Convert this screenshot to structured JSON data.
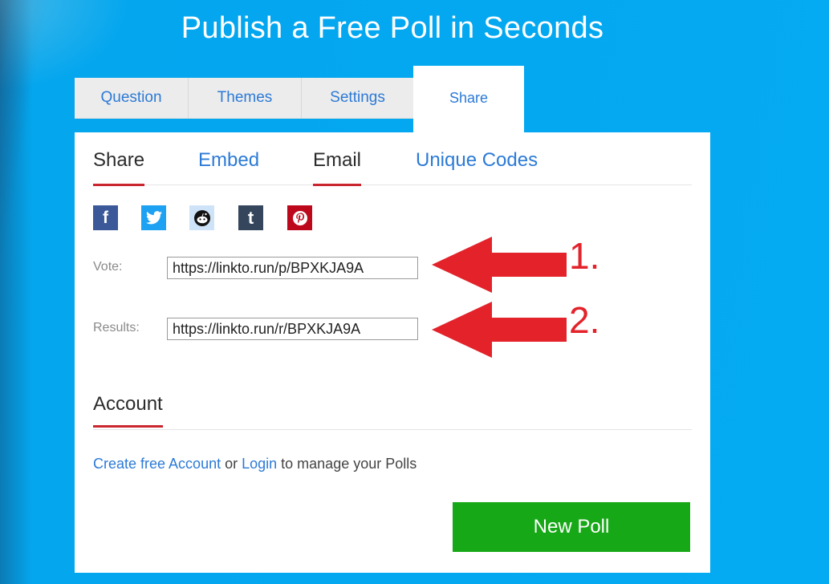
{
  "page": {
    "title": "Publish a Free Poll in Seconds"
  },
  "tabs": [
    {
      "label": "Question"
    },
    {
      "label": "Themes"
    },
    {
      "label": "Settings"
    },
    {
      "label": "Share"
    }
  ],
  "subtabs": [
    {
      "label": "Share"
    },
    {
      "label": "Embed"
    },
    {
      "label": "Email"
    },
    {
      "label": "Unique Codes"
    }
  ],
  "social": [
    {
      "icon": "facebook-icon",
      "glyph": "f",
      "color": "#3b5998"
    },
    {
      "icon": "twitter-icon",
      "glyph": "t",
      "color": "#1da1f2"
    },
    {
      "icon": "reddit-icon",
      "glyph": "r",
      "color": "#cee3f8"
    },
    {
      "icon": "tumblr-icon",
      "glyph": "t",
      "color": "#35465c"
    },
    {
      "icon": "pinterest-icon",
      "glyph": "p",
      "color": "#bd081c"
    }
  ],
  "links": {
    "vote_label": "Vote:",
    "vote_url": "https://linkto.run/p/BPXKJA9A",
    "results_label": "Results:",
    "results_url": "https://linkto.run/r/BPXKJA9A"
  },
  "annotations": {
    "one": "1.",
    "two": "2."
  },
  "account": {
    "title": "Account",
    "create_link": "Create free Account",
    "or_text": " or ",
    "login_link": "Login",
    "suffix": " to manage your Polls"
  },
  "new_poll": {
    "label": "New Poll"
  },
  "colors": {
    "accent_red": "#c9262f",
    "link_blue": "#2c7ad6",
    "button_green": "#17a817",
    "arrow_red": "#e3222a"
  }
}
